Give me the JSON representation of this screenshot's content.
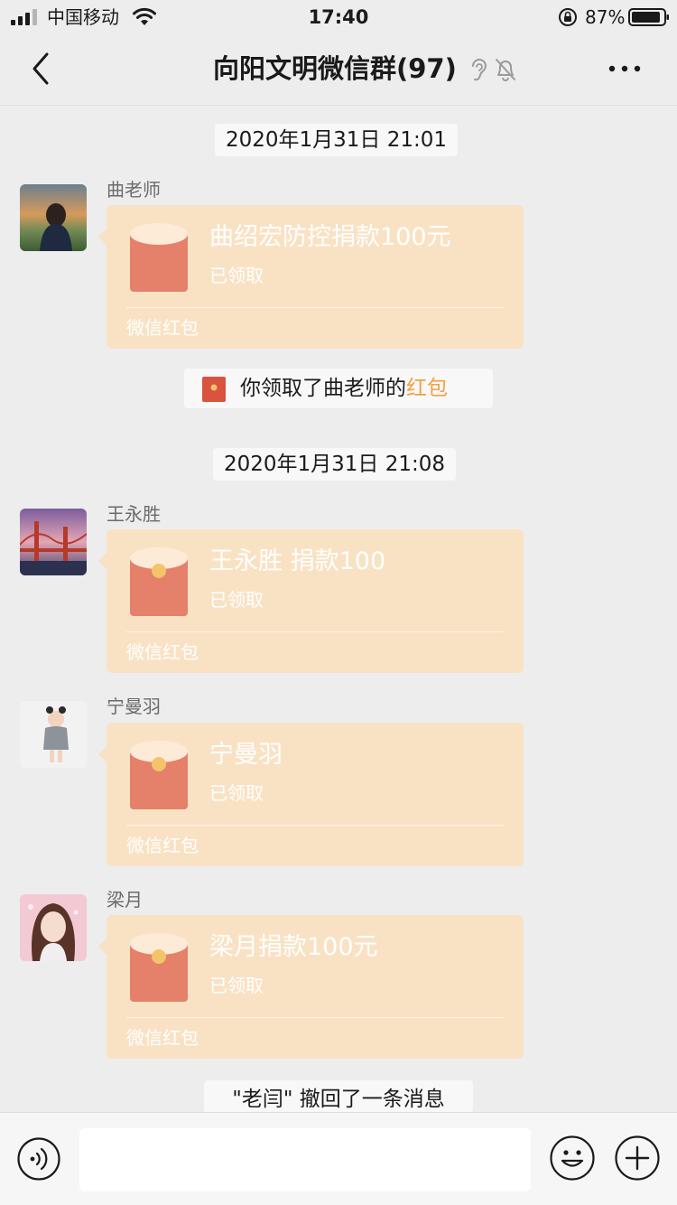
{
  "status_bar": {
    "carrier": "中国移动",
    "time": "17:40",
    "battery": "87%"
  },
  "nav": {
    "title": "向阳文明微信群(97)"
  },
  "messages": [
    {
      "timestamp": "2020年1月31日 21:01",
      "sender": "曲老师",
      "packet_title": "曲绍宏防控捐款100元",
      "packet_status": "已领取",
      "packet_footer": "微信红包"
    },
    {
      "sender": "王永胜",
      "packet_title": "王永胜  捐款100",
      "packet_status": "已领取",
      "packet_footer": "微信红包"
    },
    {
      "sender": "宁曼羽",
      "packet_title": "宁曼羽",
      "packet_status": "已领取",
      "packet_footer": "微信红包"
    },
    {
      "sender": "梁月",
      "packet_title": "梁月捐款100元",
      "packet_status": "已领取",
      "packet_footer": "微信红包"
    }
  ],
  "system_notice": {
    "text": "你领取了曲老师的",
    "link": "红包"
  },
  "second_timestamp": "2020年1月31日 21:08",
  "recall_notice": "\"老闫\" 撤回了一条消息",
  "colors": {
    "packet_bg": "#f9e2c4",
    "packet_icon": "#e5806a",
    "link": "#f0a23e",
    "chat_bg": "#ededed"
  },
  "icons": [
    "signal-icon",
    "wifi-icon",
    "lock-icon",
    "battery-icon",
    "back-icon",
    "ear-icon",
    "mute-bell-icon",
    "more-icon",
    "red-packet-icon",
    "voice-icon",
    "emoji-icon",
    "plus-icon"
  ]
}
